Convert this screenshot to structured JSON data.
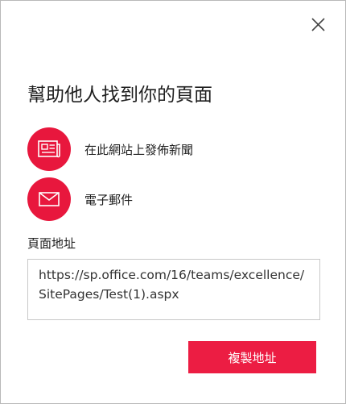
{
  "dialog": {
    "title": "幫助他人找到你的頁面",
    "close_icon": "close-icon"
  },
  "share_options": [
    {
      "label": "在此網站上發佈新聞",
      "icon": "newspaper-icon"
    },
    {
      "label": "電子郵件",
      "icon": "envelope-icon"
    }
  ],
  "address": {
    "label": "頁面地址",
    "url_line1": "https://sp.office.com/16/teams/excellence/",
    "url_line2": "SitePages/Test(1).aspx"
  },
  "actions": {
    "copy_label": "複製地址"
  },
  "colors": {
    "accent": "#e8173d",
    "button": "#ec1d43",
    "text": "#1f1f1f"
  }
}
